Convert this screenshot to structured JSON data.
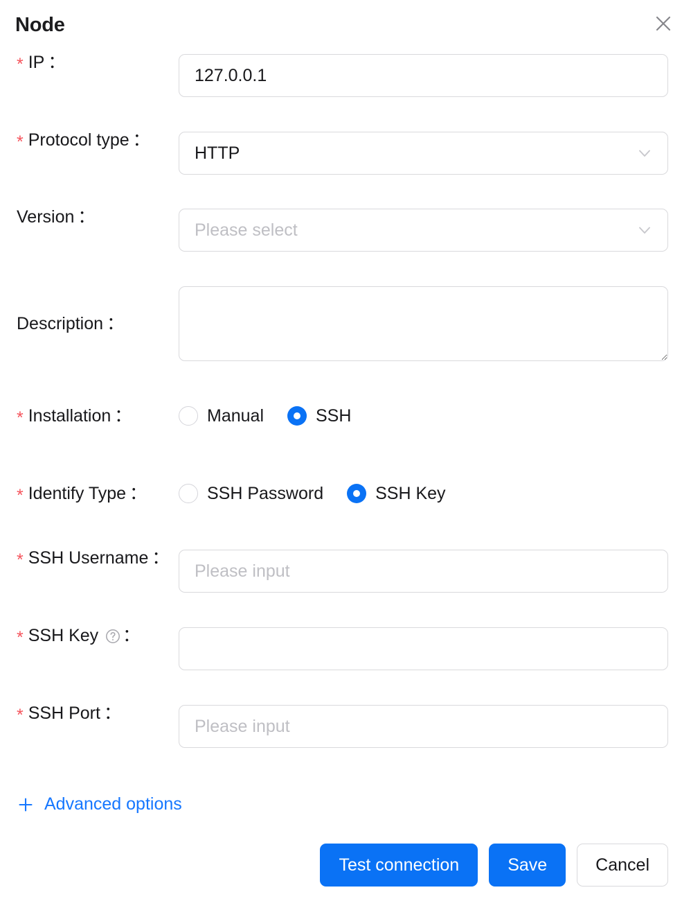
{
  "dialog": {
    "title": "Node",
    "close_icon": "close-icon"
  },
  "fields": {
    "ip": {
      "label": "IP",
      "colon": "：",
      "required": true,
      "value": "127.0.0.1",
      "placeholder": ""
    },
    "protocol_type": {
      "label": "Protocol type",
      "colon": "：",
      "required": true,
      "value": "HTTP",
      "placeholder": "Please select",
      "icon": "chevron-down-icon"
    },
    "version": {
      "label": "Version",
      "colon": "：",
      "required": false,
      "value": "",
      "placeholder": "Please select",
      "icon": "chevron-down-icon"
    },
    "description": {
      "label": "Description",
      "colon": "：",
      "required": false,
      "value": "",
      "placeholder": ""
    },
    "installation": {
      "label": "Installation",
      "colon": "：",
      "required": true,
      "selected": "SSH",
      "options": [
        {
          "label": "Manual",
          "checked": false
        },
        {
          "label": "SSH",
          "checked": true
        }
      ]
    },
    "identify_type": {
      "label": "Identify Type",
      "colon": "：",
      "required": true,
      "selected": "SSH Key",
      "options": [
        {
          "label": "SSH Password",
          "checked": false
        },
        {
          "label": "SSH Key",
          "checked": true
        }
      ]
    },
    "ssh_username": {
      "label": "SSH Username",
      "colon": "：",
      "required": true,
      "value": "",
      "placeholder": "Please input"
    },
    "ssh_key": {
      "label": "SSH Key",
      "colon": "：",
      "required": true,
      "value": "",
      "placeholder": "",
      "help_icon": "help-circle-icon"
    },
    "ssh_port": {
      "label": "SSH Port",
      "colon": "：",
      "required": true,
      "value": "",
      "placeholder": "Please input"
    }
  },
  "advanced": {
    "label": "Advanced options",
    "icon": "plus-icon"
  },
  "footer": {
    "test_connection": "Test connection",
    "save": "Save",
    "cancel": "Cancel"
  },
  "colors": {
    "primary": "#0a72f5",
    "link": "#1677ff",
    "required_star": "#f5555d",
    "border": "#d9d9dc",
    "placeholder": "#bfbfc4",
    "text": "#18181b"
  },
  "star": "*"
}
